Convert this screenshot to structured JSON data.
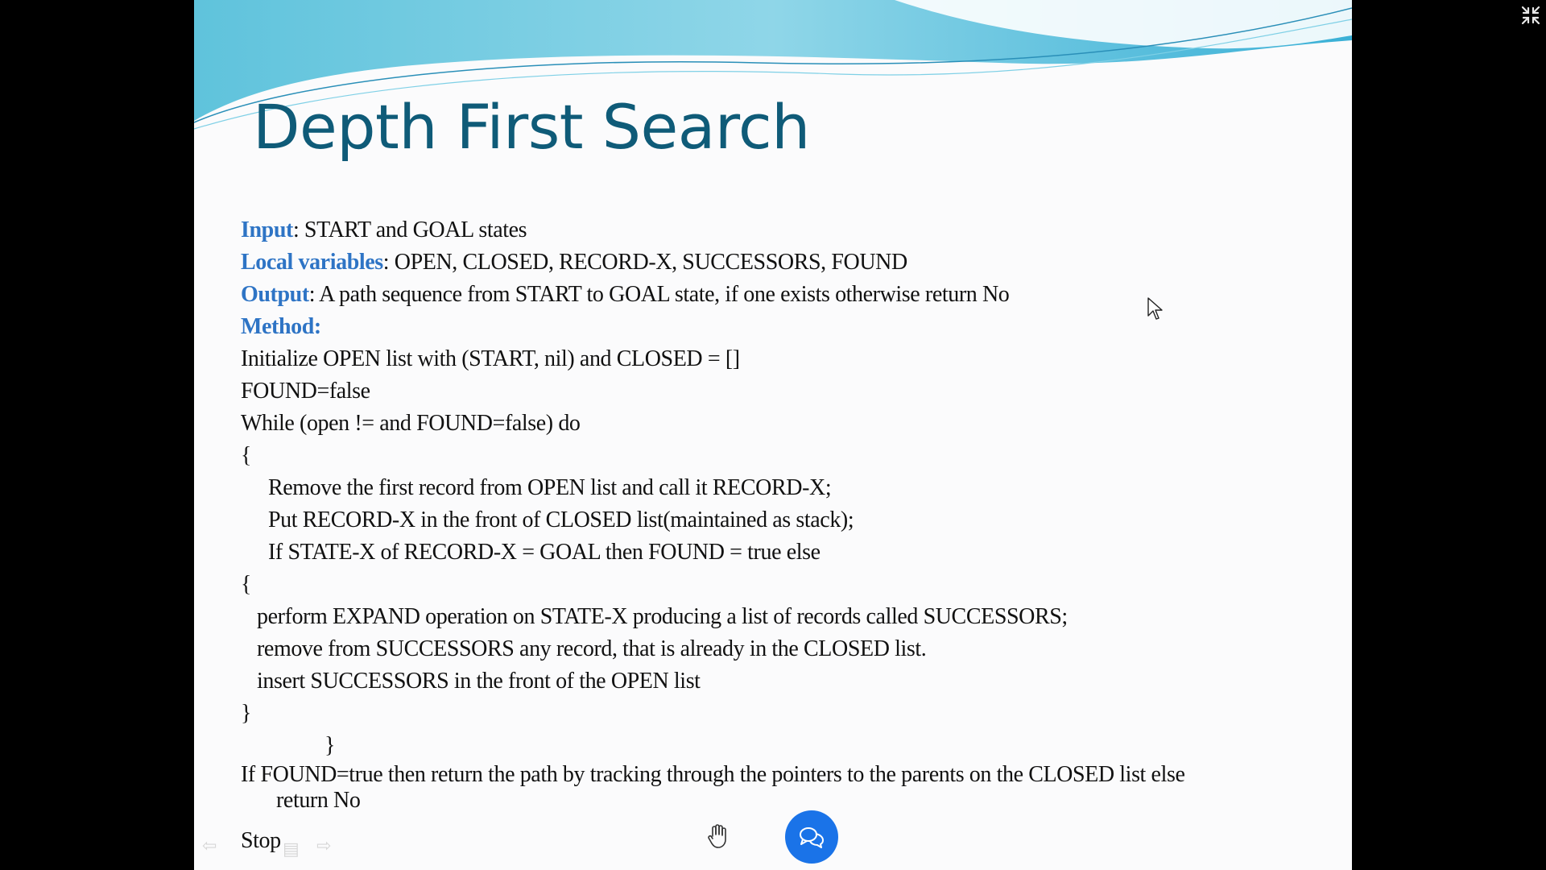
{
  "slide": {
    "title": "Depth First Search",
    "input": {
      "label": "Input",
      "text": ": START and GOAL states"
    },
    "local_variables": {
      "label": "Local variables",
      "text": ": OPEN, CLOSED, RECORD-X, SUCCESSORS, FOUND"
    },
    "output": {
      "label": "Output",
      "text": ": A path sequence from START to GOAL state, if one exists otherwise return No"
    },
    "method": {
      "label": "Method:"
    },
    "steps": {
      "init": "Initialize OPEN list with (START, nil)  and CLOSED = []",
      "found_false": "FOUND=false",
      "while": "While (open !=   and FOUND=false) do",
      "open_brace_1": "{",
      "remove": "Remove the first record  from OPEN list  and call it RECORD-X;",
      "put": "Put RECORD-X in the front of CLOSED list(maintained as stack);",
      "if_state": "If STATE-X of RECORD-X = GOAL then FOUND = true else",
      "open_brace_2": "{",
      "expand": "perform EXPAND operation on STATE-X producing a list of  records called SUCCESSORS;",
      "remove_succ": "remove from SUCCESSORS any record, that is already in the CLOSED list.",
      "insert": "insert SUCCESSORS in the front of  the OPEN list",
      "close_brace_2": "}",
      "close_brace_1": "}",
      "if_found": "If FOUND=true then return the path by tracking through the pointers to the parents on the CLOSED list else",
      "return_no": "return No",
      "stop": "Stop"
    }
  },
  "controls": {
    "prev_icon": "arrow-left-icon",
    "menu_icon": "menu-icon",
    "next_icon": "arrow-right-icon",
    "hand_icon": "raise-hand-icon",
    "chat_icon": "chat-icon",
    "exit_fullscreen_icon": "exit-fullscreen-icon"
  },
  "colors": {
    "title": "#0f5b78",
    "keyword": "#2e74c5",
    "chat_button": "#1a73e8"
  }
}
